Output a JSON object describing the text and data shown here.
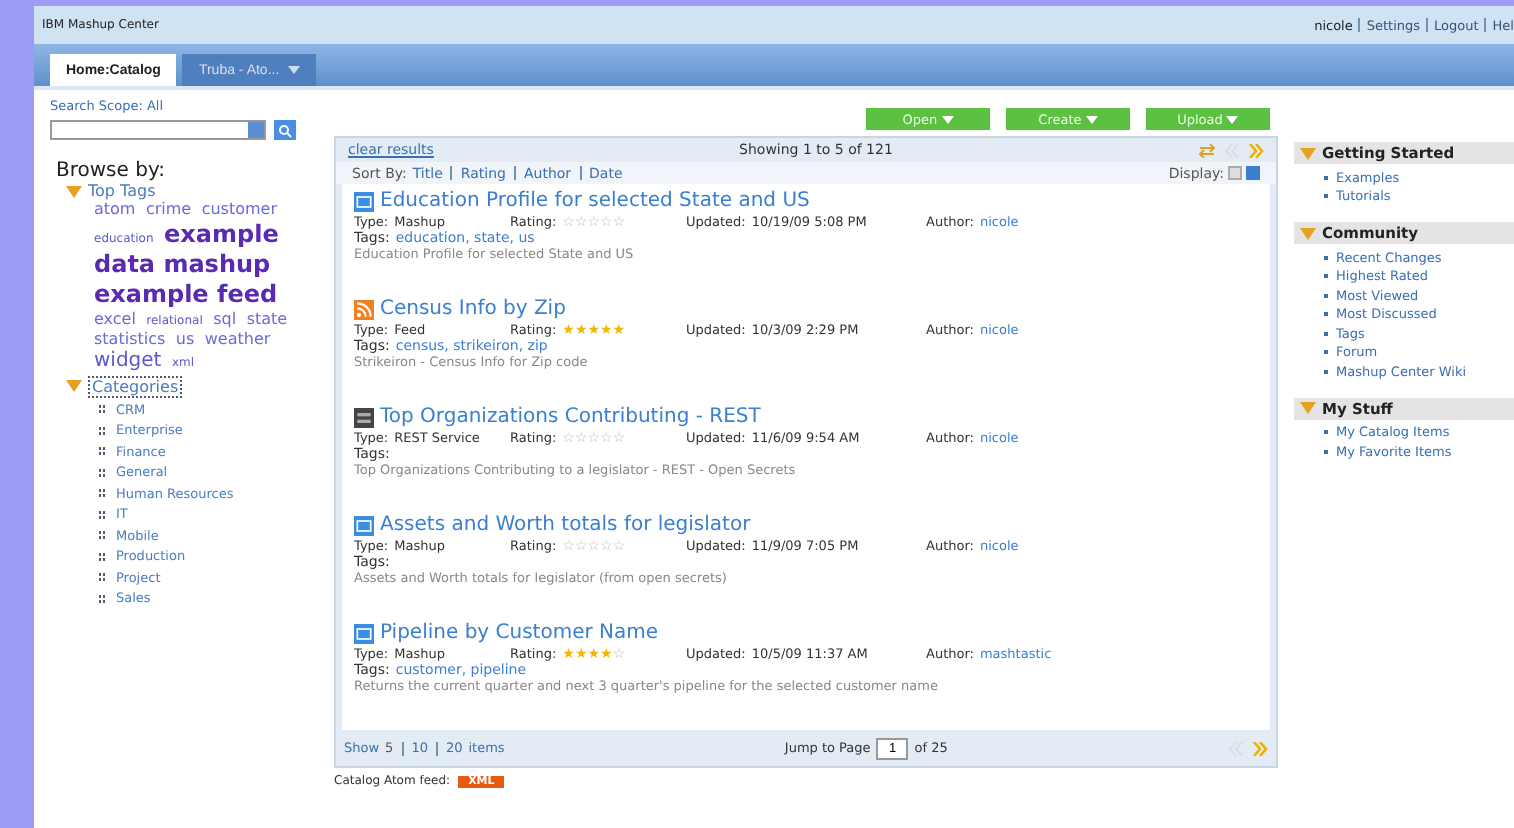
{
  "window": {
    "title": "IBM Mashup Center"
  },
  "user_links": [
    "nicole",
    "Settings",
    "Logout",
    "Hel"
  ],
  "tabs": [
    {
      "label": "Home:Catalog",
      "selected": true,
      "menu": false
    },
    {
      "label": "Truba - Ato...",
      "selected": false,
      "menu": true
    }
  ],
  "search": {
    "scope_label": "Search Scope:",
    "scope": "All"
  },
  "browse": {
    "title": "Browse by:",
    "top_tags": {
      "label": "Top Tags",
      "expanded": true
    },
    "tags": [
      {
        "label": "atom",
        "kind": "small"
      },
      {
        "label": "crime",
        "kind": "small"
      },
      {
        "label": "customer",
        "kind": "small"
      },
      {
        "label": "education",
        "kind": "tiny"
      },
      {
        "label": "example",
        "kind": "large"
      },
      {
        "label": "data mashup",
        "kind": "large"
      },
      {
        "label": "example feed",
        "kind": "large"
      },
      {
        "label": "excel",
        "kind": "small"
      },
      {
        "label": "relational",
        "kind": "tiny"
      },
      {
        "label": "sql",
        "kind": "small"
      },
      {
        "label": "state",
        "kind": "small"
      },
      {
        "label": "statistics",
        "kind": "small"
      },
      {
        "label": "us",
        "kind": "small"
      },
      {
        "label": "weather",
        "kind": "small"
      },
      {
        "label": "widget",
        "kind": "medium"
      },
      {
        "label": "xml",
        "kind": "tiny"
      }
    ],
    "categories": {
      "label": "Categories",
      "expanded": true
    },
    "category_items": [
      "CRM",
      "Enterprise",
      "Finance",
      "General",
      "Human Resources",
      "IT",
      "Mobile",
      "Production",
      "Project",
      "Sales"
    ]
  },
  "actions": [
    "Open",
    "Create",
    "Upload"
  ],
  "results": {
    "clear": "clear results",
    "showing": "Showing 1 to 5 of 121",
    "sort_label": "Sort By:",
    "sort_options": [
      "Title",
      "Rating",
      "Author",
      "Date"
    ],
    "display_label": "Display:",
    "views": [
      {
        "selected": false
      },
      {
        "selected": true
      }
    ],
    "items": [
      {
        "kind": "mashup",
        "title": "Education Profile for selected State and US",
        "type_label": "Type:",
        "type": "Mashup",
        "rating_label": "Rating:",
        "stars": 0,
        "updated_label": "Updated:",
        "updated": "10/19/09 5:08 PM",
        "author_label": "Author:",
        "author": "nicole",
        "tags_label": "Tags:",
        "tags": "education, state, us",
        "description": "Education Profile for selected State and US"
      },
      {
        "kind": "feed",
        "title": "Census Info by Zip",
        "type_label": "Type:",
        "type": "Feed",
        "rating_label": "Rating:",
        "stars": 5,
        "updated_label": "Updated:",
        "updated": "10/3/09 2:29 PM",
        "author_label": "Author:",
        "author": "nicole",
        "tags_label": "Tags:",
        "tags": "census, strikeiron, zip",
        "description": "Strikeiron - Census Info for Zip code"
      },
      {
        "kind": "service",
        "title": "Top Organizations Contributing - REST",
        "type_label": "Type:",
        "type": "REST Service",
        "rating_label": "Rating:",
        "stars": 0,
        "updated_label": "Updated:",
        "updated": "11/6/09 9:54 AM",
        "author_label": "Author:",
        "author": "nicole",
        "tags_label": "Tags:",
        "description": "Top Organizations Contributing to a legislator - REST - Open Secrets"
      },
      {
        "kind": "mashup",
        "title": "Assets and Worth totals for legislator",
        "type_label": "Type:",
        "type": "Mashup",
        "rating_label": "Rating:",
        "stars": 0,
        "updated_label": "Updated:",
        "updated": "11/9/09 7:05 PM",
        "author_label": "Author:",
        "author": "nicole",
        "tags_label": "Tags:",
        "description": "Assets and Worth totals for legislator (from open secrets)"
      },
      {
        "kind": "mashup",
        "title": "Pipeline by Customer Name",
        "type_label": "Type:",
        "type": "Mashup",
        "rating_label": "Rating:",
        "stars": 4,
        "updated_label": "Updated:",
        "updated": "10/5/09 11:37 AM",
        "author_label": "Author:",
        "author": "mashtastic",
        "tags_label": "Tags:",
        "tags": "customer, pipeline",
        "description": "Returns the current quarter and next 3 quarter's pipeline for the selected customer name"
      }
    ],
    "show_label": "Show",
    "page_sizes": [
      {
        "label": "5",
        "selected": true
      },
      {
        "label": "10",
        "selected": false
      },
      {
        "label": "20",
        "selected": false
      }
    ],
    "items_label": "items",
    "jump_label": "Jump to Page",
    "page": "1",
    "of_pages": "of 25"
  },
  "feed": {
    "label": "Catalog Atom feed:",
    "badge": "XML"
  },
  "sidebar": [
    {
      "title": "Getting Started",
      "expanded": true,
      "links": [
        "Examples",
        "Tutorials"
      ]
    },
    {
      "title": "Community",
      "expanded": true,
      "links": [
        "Recent Changes",
        "Highest Rated",
        "Most Viewed",
        "Most Discussed",
        "Tags",
        "Forum",
        "Mashup Center Wiki"
      ]
    },
    {
      "title": "My Stuff",
      "expanded": true,
      "links": [
        "My Catalog Items",
        "My Favorite Items"
      ]
    }
  ]
}
